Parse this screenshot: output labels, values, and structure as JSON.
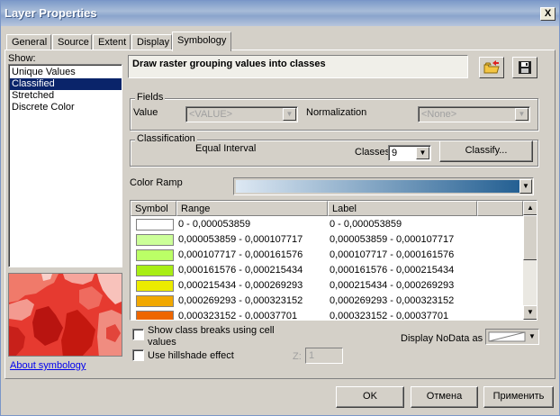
{
  "window": {
    "title": "Layer Properties",
    "close_label": "X"
  },
  "tabs": [
    {
      "label": "General"
    },
    {
      "label": "Source"
    },
    {
      "label": "Extent"
    },
    {
      "label": "Display"
    },
    {
      "label": "Symbology",
      "active": true
    }
  ],
  "show": {
    "label": "Show:",
    "items": [
      {
        "label": "Unique Values"
      },
      {
        "label": "Classified",
        "selected": true
      },
      {
        "label": "Stretched"
      },
      {
        "label": "Discrete Color"
      }
    ],
    "about_link": "About symbology"
  },
  "header": {
    "description": "Draw raster grouping values into classes",
    "open_icon": "folder-open-icon",
    "save_icon": "floppy-disk-icon"
  },
  "fields": {
    "group_label": "Fields",
    "value_label": "Value",
    "value_selected": "<VALUE>",
    "normalization_label": "Normalization",
    "normalization_selected": "<None>"
  },
  "classification": {
    "group_label": "Classification",
    "method": "Equal Interval",
    "classes_label": "Classes",
    "classes_value": "9",
    "classify_button": "Classify..."
  },
  "color_ramp": {
    "label": "Color Ramp",
    "start_color": "#dde8f3",
    "end_color": "#235f92"
  },
  "table": {
    "columns": {
      "symbol": "Symbol",
      "range": "Range",
      "label": "Label"
    },
    "rows": [
      {
        "color": "#ffffff",
        "range": "0 - 0,000053859",
        "label": "0 - 0,000053859"
      },
      {
        "color": "#ccff99",
        "range": "0,000053859 - 0,000107717",
        "label": "0,000053859 - 0,000107717"
      },
      {
        "color": "#bbff66",
        "range": "0,000107717 - 0,000161576",
        "label": "0,000107717 - 0,000161576"
      },
      {
        "color": "#a8ee14",
        "range": "0,000161576 - 0,000215434",
        "label": "0,000161576 - 0,000215434"
      },
      {
        "color": "#ecec00",
        "range": "0,000215434 - 0,000269293",
        "label": "0,000215434 - 0,000269293"
      },
      {
        "color": "#f1a800",
        "range": "0,000269293 - 0,000323152",
        "label": "0,000269293 - 0,000323152"
      },
      {
        "color": "#ee6600",
        "range": "0,000323152 - 0,00037701",
        "label": "0,000323152 - 0,00037701"
      }
    ]
  },
  "options": {
    "show_breaks_line1": "Show class breaks using cell",
    "show_breaks_line2": "values",
    "hillshade": "Use hillshade effect",
    "z_label": "Z:",
    "z_value": "1",
    "nodata_label": "Display NoData as"
  },
  "buttons": {
    "ok": "OK",
    "cancel": "Отмена",
    "apply": "Применить"
  }
}
